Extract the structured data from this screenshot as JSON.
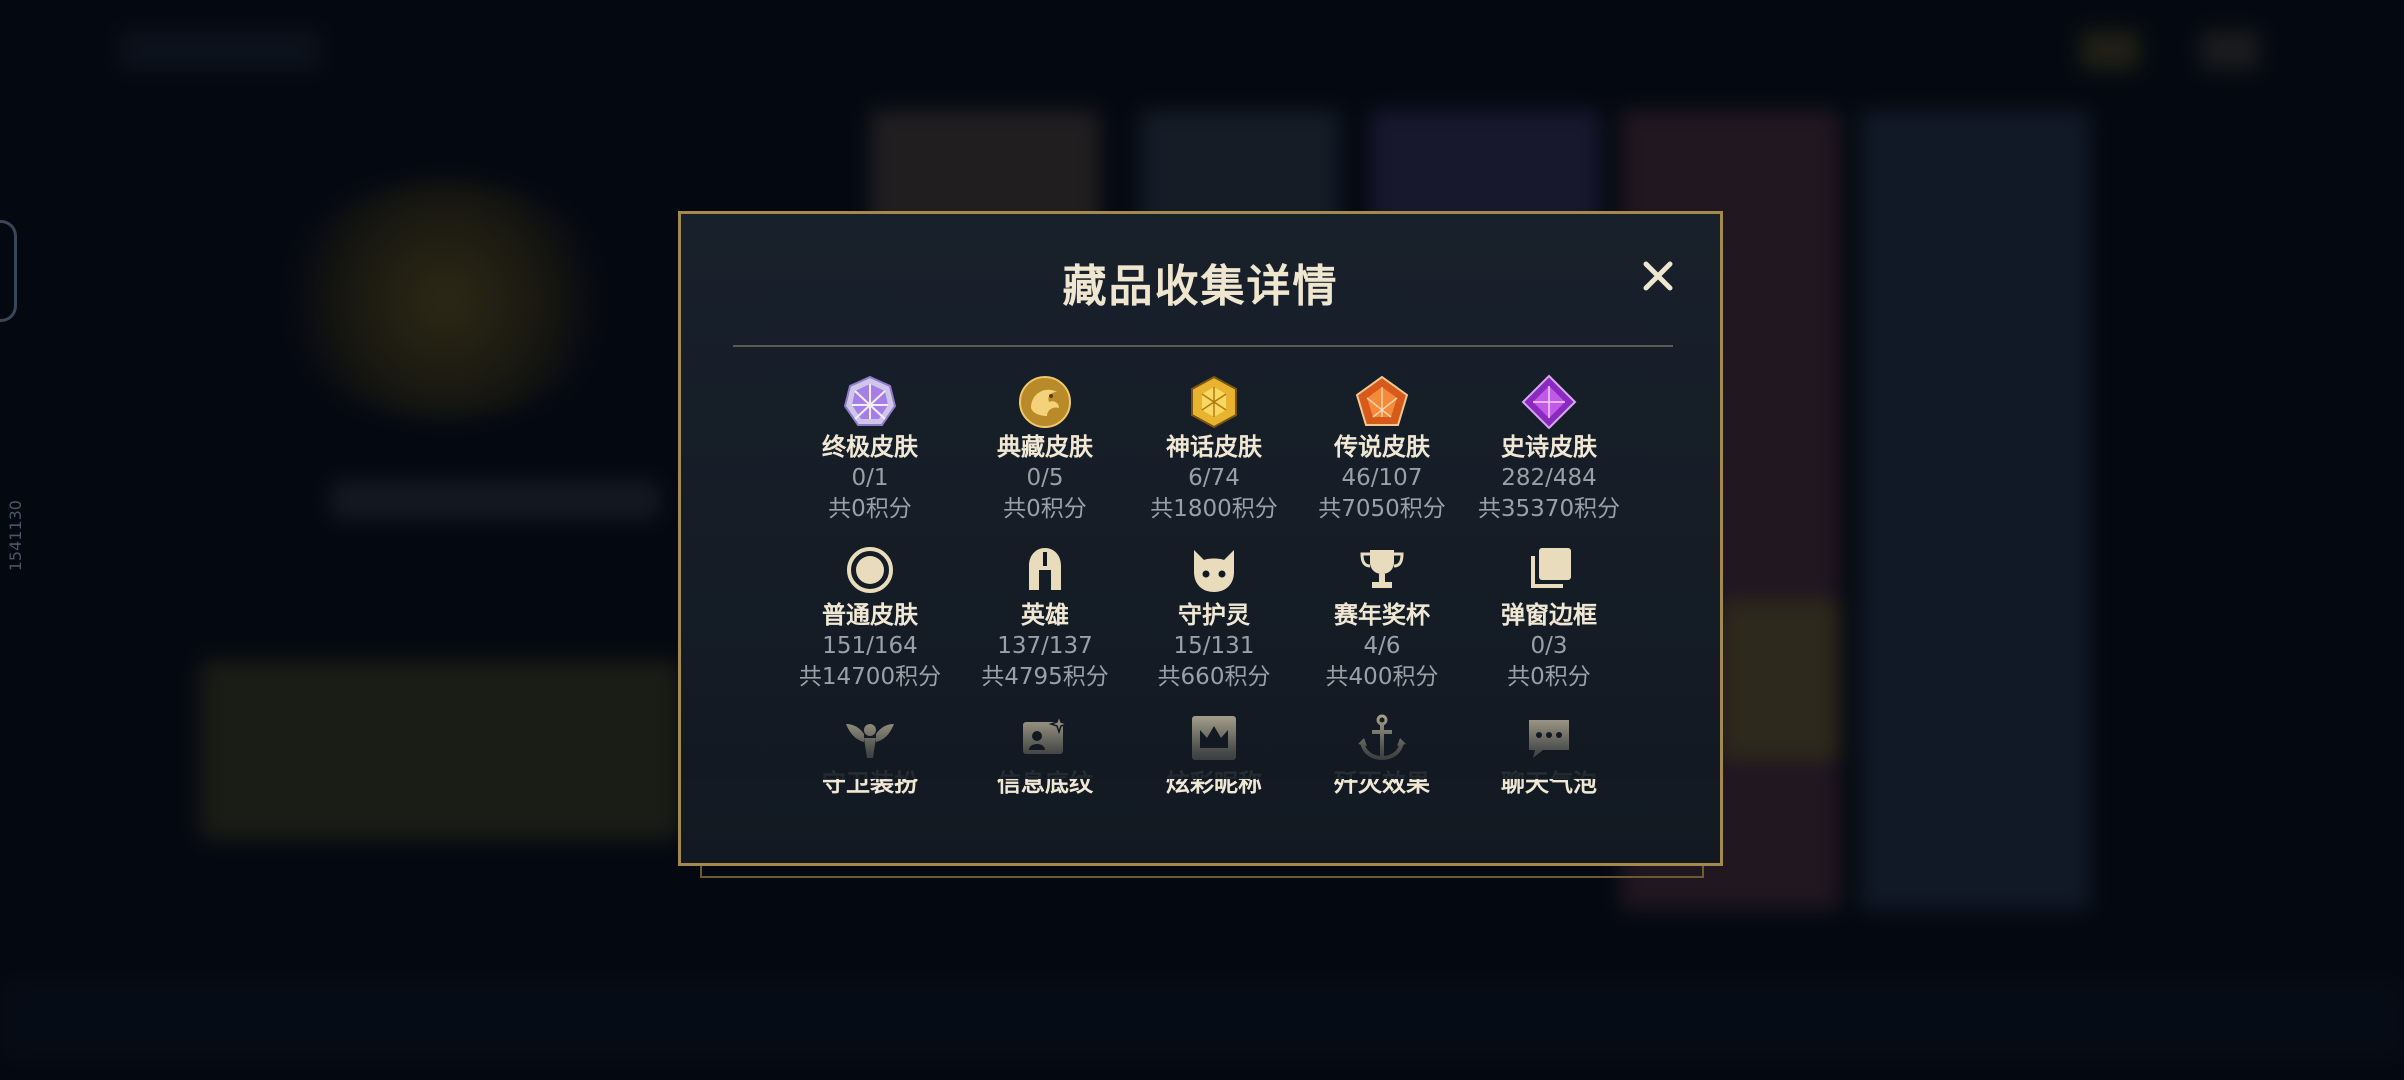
{
  "side_id": "1541130",
  "modal": {
    "title": "藏品收集详情",
    "close_label": "×"
  },
  "items": [
    {
      "name": "终极皮肤",
      "count": "0/1",
      "points": "共0积分",
      "icon": "ultimate-gem-icon"
    },
    {
      "name": "典藏皮肤",
      "count": "0/5",
      "points": "共0积分",
      "icon": "exalted-dragon-icon"
    },
    {
      "name": "神话皮肤",
      "count": "6/74",
      "points": "共1800积分",
      "icon": "mythic-gem-icon"
    },
    {
      "name": "传说皮肤",
      "count": "46/107",
      "points": "共7050积分",
      "icon": "legendary-gem-icon"
    },
    {
      "name": "史诗皮肤",
      "count": "282/484",
      "points": "共35370积分",
      "icon": "epic-gem-icon"
    },
    {
      "name": "普通皮肤",
      "count": "151/164",
      "points": "共14700积分",
      "icon": "ring-icon"
    },
    {
      "name": "英雄",
      "count": "137/137",
      "points": "共4795积分",
      "icon": "helmet-icon"
    },
    {
      "name": "守护灵",
      "count": "15/131",
      "points": "共660积分",
      "icon": "spirit-icon"
    },
    {
      "name": "赛年奖杯",
      "count": "4/6",
      "points": "共400积分",
      "icon": "trophy-icon"
    },
    {
      "name": "弹窗边框",
      "count": "0/3",
      "points": "共0积分",
      "icon": "frame-icon"
    },
    {
      "name": "守卫装扮",
      "icon": "ward-icon"
    },
    {
      "name": "信息底纹",
      "icon": "card-icon"
    },
    {
      "name": "炫彩昵称",
      "icon": "crown-icon"
    },
    {
      "name": "歼灭效果",
      "icon": "anchor-icon"
    },
    {
      "name": "聊天气泡",
      "icon": "chat-bubble-icon"
    }
  ],
  "colors": {
    "gold": "#a4894c",
    "text": "#f0e8d4",
    "muted": "#9aa0a8"
  }
}
